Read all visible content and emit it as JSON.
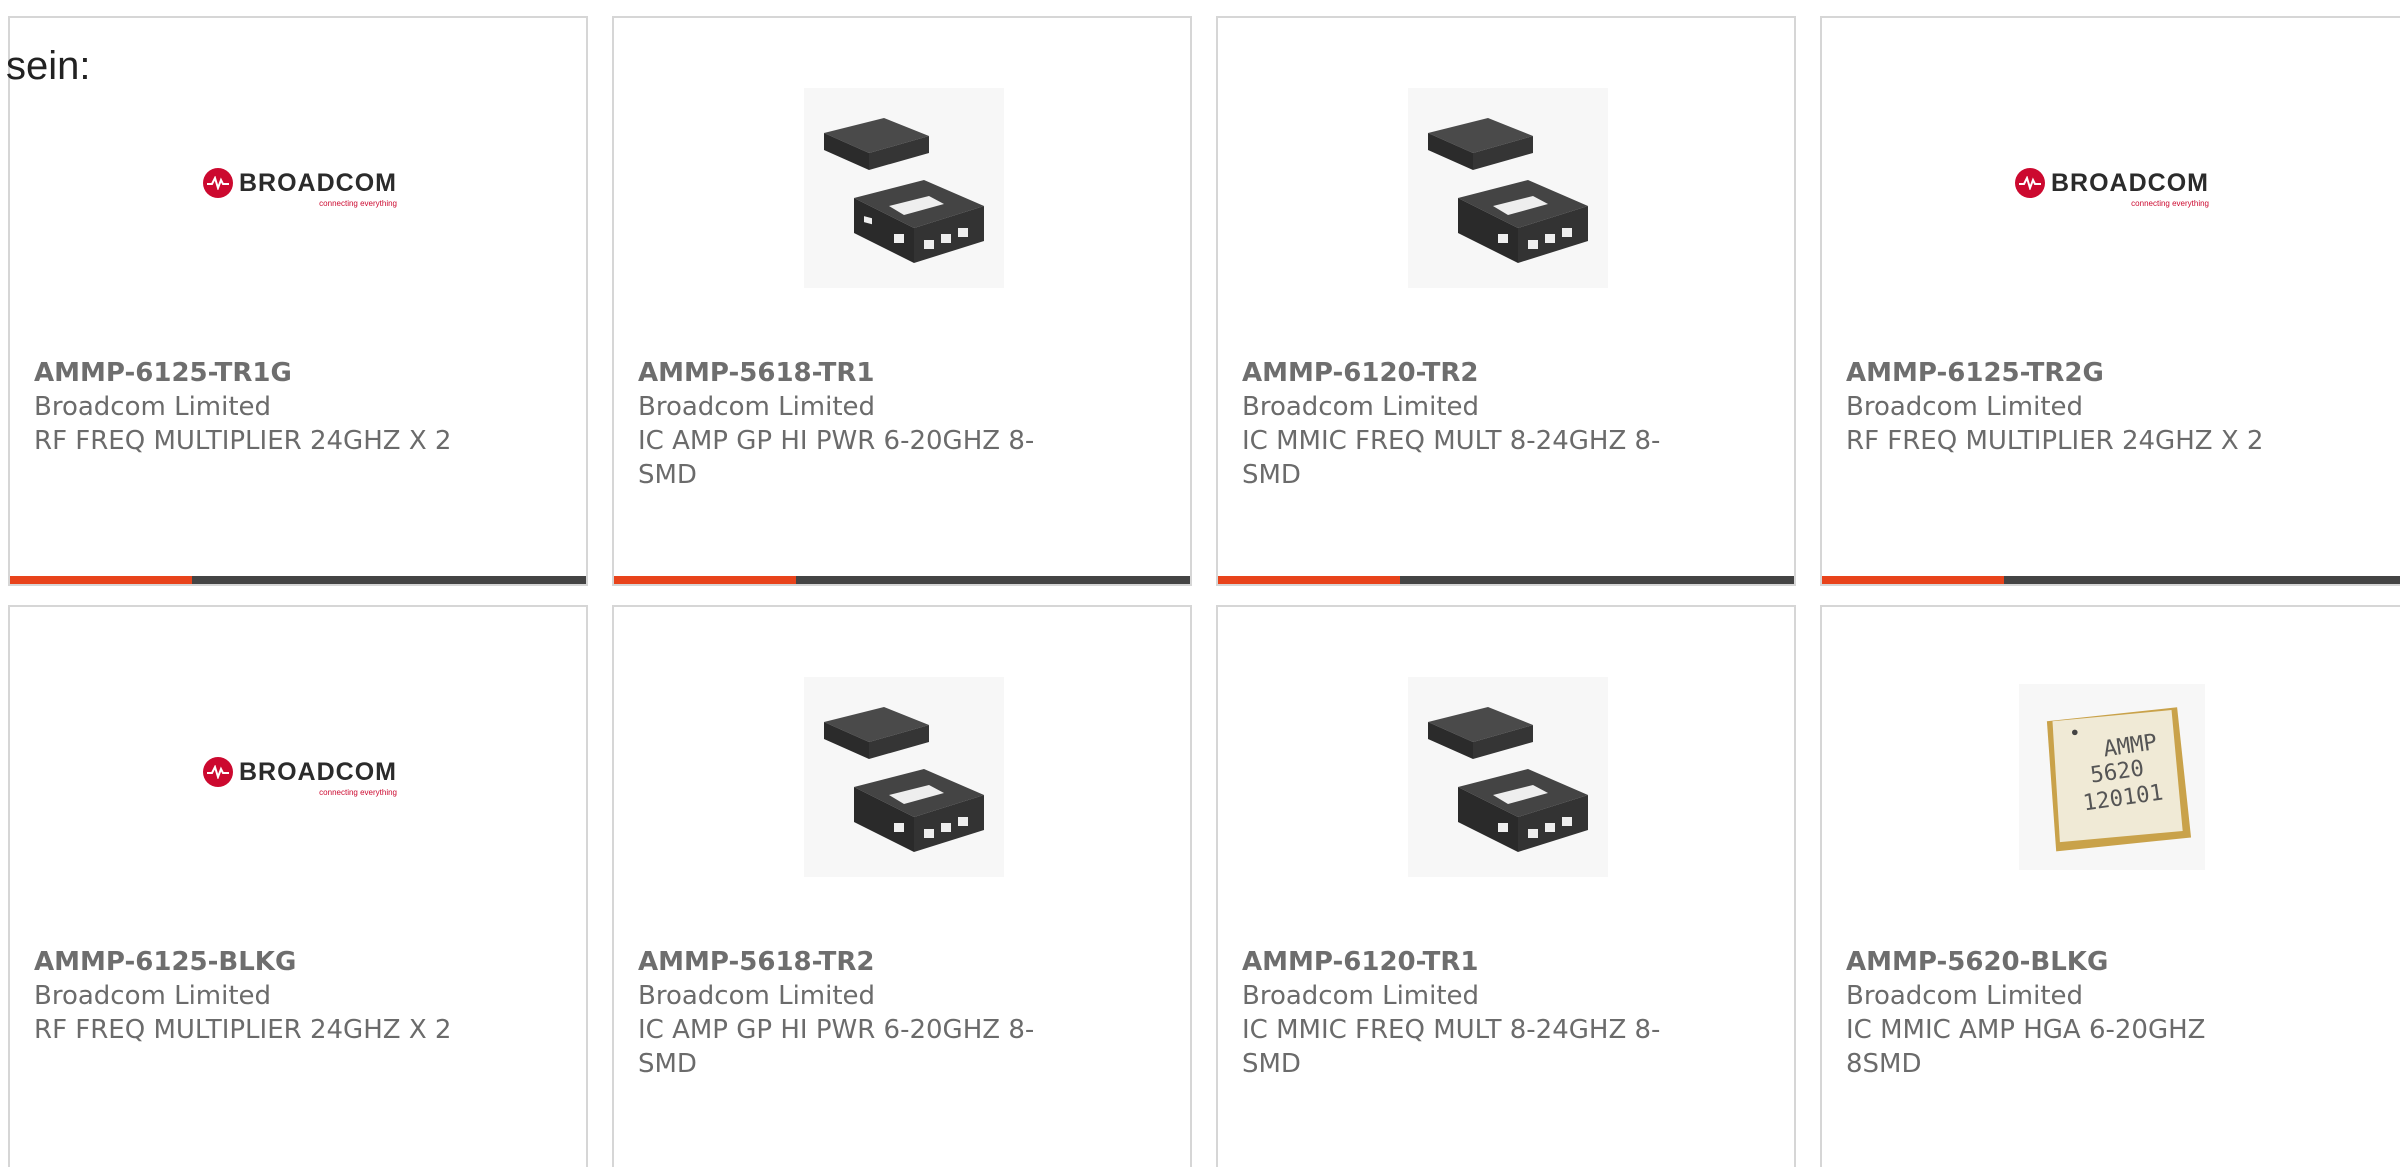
{
  "intro_text": "sein:",
  "logo": {
    "word": "BROADCOM",
    "tagline": "connecting everything",
    "brand_color": "#cc092f"
  },
  "accent_color": "#e8431b",
  "products": [
    {
      "part_number": "AMMP-6125-TR1G",
      "manufacturer": "Broadcom Limited",
      "description": "RF FREQ MULTIPLIER 24GHZ X 2",
      "image": "broadcom-logo"
    },
    {
      "part_number": "AMMP-5618-TR1",
      "manufacturer": "Broadcom Limited",
      "description": "IC AMP GP HI PWR 6-20GHZ 8-SMD",
      "image": "qfn-chip"
    },
    {
      "part_number": "AMMP-6120-TR2",
      "manufacturer": "Broadcom Limited",
      "description": "IC MMIC FREQ MULT 8-24GHZ 8-SMD",
      "image": "qfn-chip"
    },
    {
      "part_number": "AMMP-6125-TR2G",
      "manufacturer": "Broadcom Limited",
      "description": "RF FREQ MULTIPLIER 24GHZ X 2",
      "image": "broadcom-logo"
    },
    {
      "part_number": "AMMP-6125-BLKG",
      "manufacturer": "Broadcom Limited",
      "description": "RF FREQ MULTIPLIER 24GHZ X 2",
      "image": "broadcom-logo"
    },
    {
      "part_number": "AMMP-5618-TR2",
      "manufacturer": "Broadcom Limited",
      "description": "IC AMP GP HI PWR 6-20GHZ 8-SMD",
      "image": "qfn-chip"
    },
    {
      "part_number": "AMMP-6120-TR1",
      "manufacturer": "Broadcom Limited",
      "description": "IC MMIC FREQ MULT 8-24GHZ 8-SMD",
      "image": "qfn-chip"
    },
    {
      "part_number": "AMMP-5620-BLKG",
      "manufacturer": "Broadcom Limited",
      "description": "IC MMIC AMP HGA 6-20GHZ 8SMD",
      "image": "ceramic-chip",
      "chip_marking": [
        "AMMP",
        "5620",
        "120101"
      ]
    }
  ]
}
